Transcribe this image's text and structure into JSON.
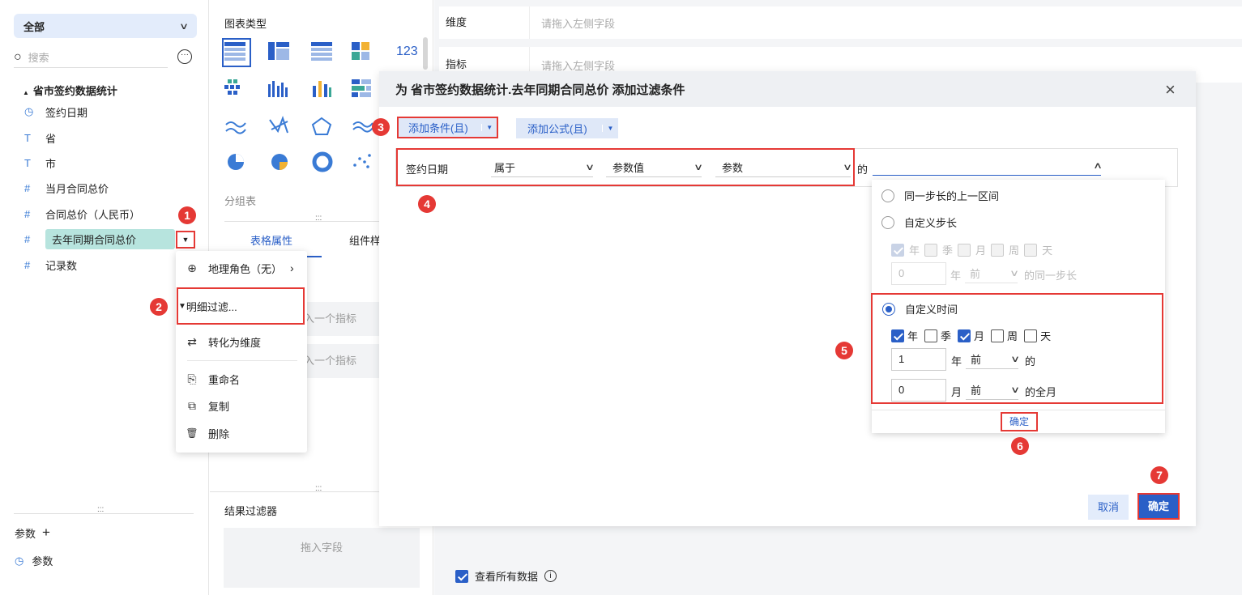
{
  "left": {
    "scope": "全部",
    "search_placeholder": "搜索",
    "dataset": "省市签约数据统计",
    "fields": [
      {
        "icon": "◷",
        "label": "签约日期"
      },
      {
        "icon": "T",
        "label": "省"
      },
      {
        "icon": "T",
        "label": "市"
      },
      {
        "icon": "#",
        "label": "当月合同总价"
      },
      {
        "icon": "#",
        "label": "合同总价（人民币）"
      },
      {
        "icon": "#",
        "label": "去年同期合同总价"
      },
      {
        "icon": "#",
        "label": "记录数"
      }
    ],
    "params_label": "参数",
    "params_item": "参数"
  },
  "menu": {
    "items": [
      {
        "icon": "⊕",
        "label": "地理角色（无）"
      },
      {
        "icon": "▼",
        "label": "明细过滤..."
      },
      {
        "icon": "⇄",
        "label": "转化为维度"
      },
      {
        "icon": "⎘",
        "label": "重命名"
      },
      {
        "icon": "⧉",
        "label": "复制"
      },
      {
        "icon": "🗑",
        "label": "删除"
      }
    ]
  },
  "middle": {
    "chart_type_label": "图表类型",
    "group_table": "分组表",
    "tab_table_attr": "表格属性",
    "tab_component": "组件样",
    "drop_metric_1": "入一个指标",
    "drop_metric_2": "入一个指标",
    "result_filter": "结果过滤器",
    "drop_field": "拖入字段"
  },
  "right": {
    "dimension_label": "维度",
    "dimension_placeholder": "请拖入左侧字段",
    "metric_label": "指标",
    "metric_placeholder": "请拖入左侧字段",
    "view_all_data": "查看所有数据"
  },
  "dialog": {
    "title": "为 省市签约数据统计.去年同期合同总价 添加过滤条件",
    "add_condition": "添加条件(且)",
    "add_formula": "添加公式(且)",
    "condition": {
      "field": "签约日期",
      "operator": "属于",
      "value_type": "参数值",
      "param": "参数",
      "of": "的"
    },
    "cancel": "取消",
    "ok": "确定"
  },
  "popup": {
    "opt1": "同一步长的上一区间",
    "opt2": "自定义步长",
    "units": [
      "年",
      "季",
      "月",
      "周",
      "天"
    ],
    "step_value": "0",
    "step_unit": "年",
    "step_dir": "前",
    "step_suffix": "的同一步长",
    "opt3": "自定义时间",
    "row1_value": "1",
    "row1_unit": "年",
    "row1_dir": "前",
    "row1_suffix": "的",
    "row2_value": "0",
    "row2_unit": "月",
    "row2_dir": "前",
    "row2_suffix": "的全月",
    "confirm": "确定"
  },
  "badges": [
    "1",
    "2",
    "3",
    "4",
    "5",
    "6",
    "7"
  ],
  "colors": {
    "accent": "#2a5fc7",
    "highlight": "#e53935",
    "selected_field_bg": "#b7e4de"
  }
}
